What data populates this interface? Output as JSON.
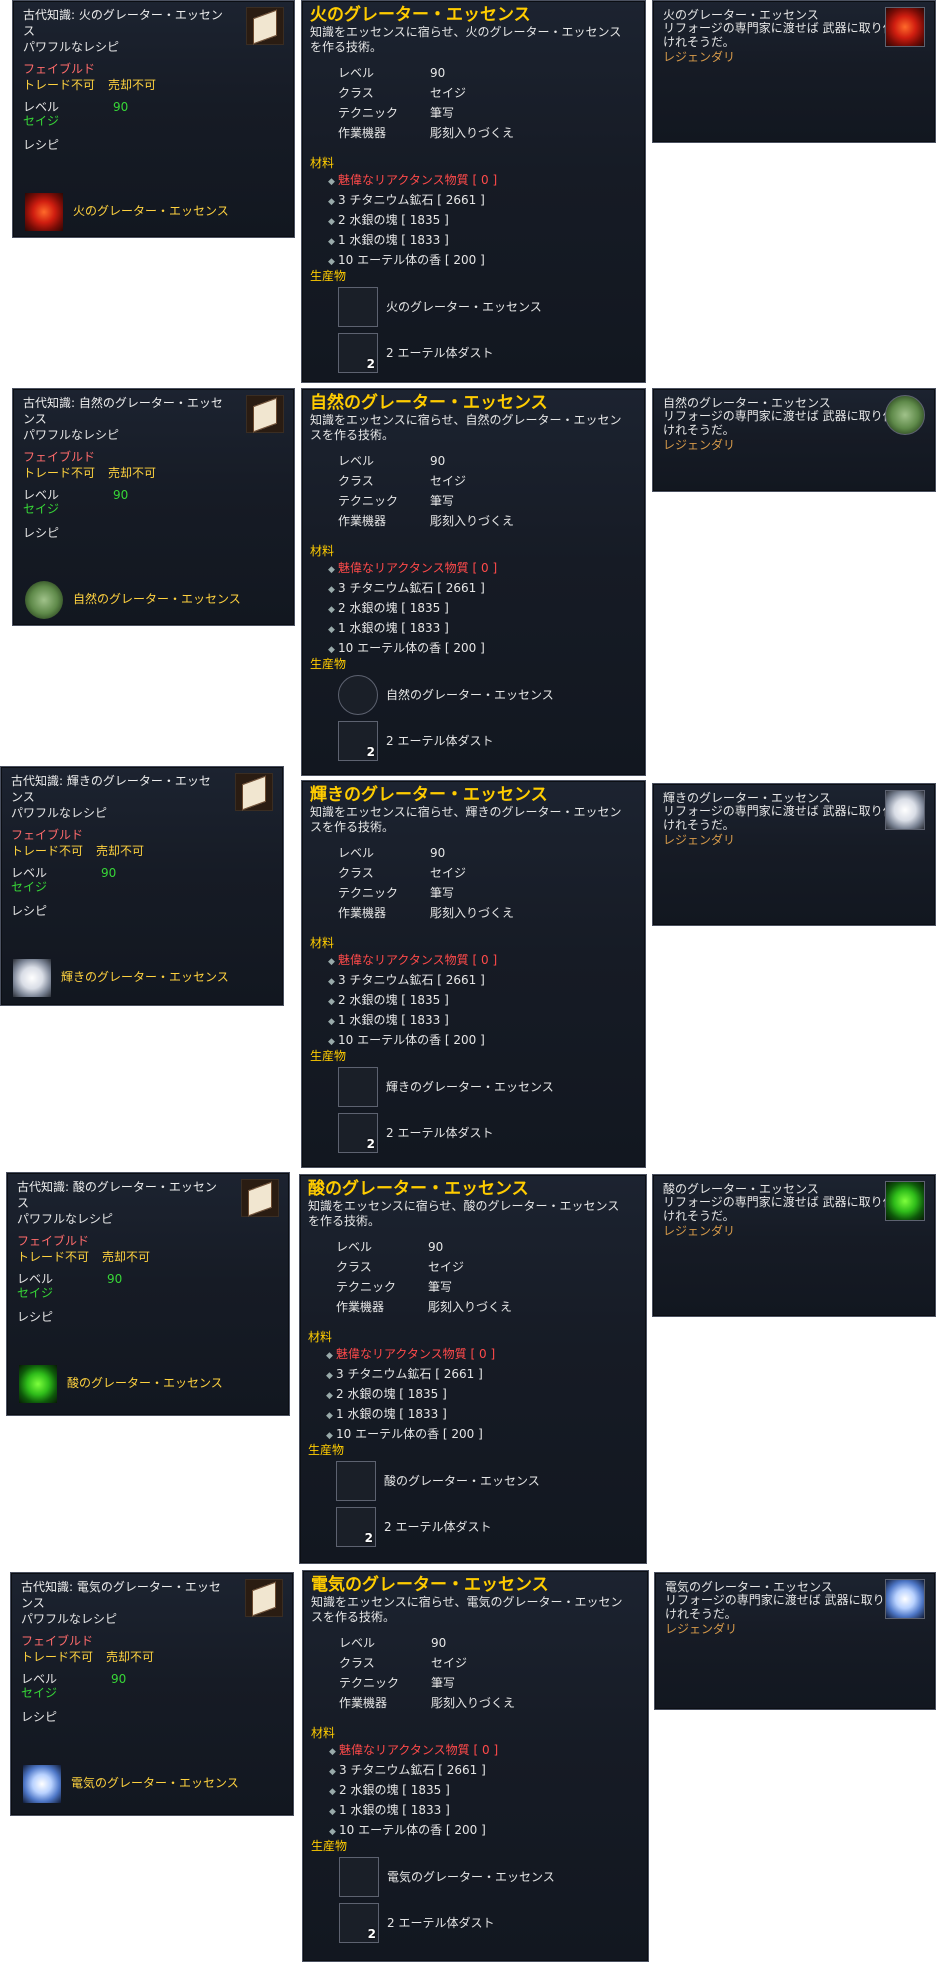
{
  "recipe_common": {
    "subtitle": "パワフルなレシピ",
    "bound": "フェイブルド",
    "no_trade": "トレード不可",
    "no_sell": "売却不可",
    "level_label": "レベル",
    "level_value": "90",
    "class_value": "セイジ",
    "recipe_label": "レシピ"
  },
  "detail_common": {
    "desc_prefix": "知識をエッセンスに宿らせ、",
    "rows": [
      {
        "label": "レベル",
        "value": "90"
      },
      {
        "label": "クラス",
        "value": "セイジ"
      },
      {
        "label": "テクニック",
        "value": "筆写"
      },
      {
        "label": "作業機器",
        "value": "彫刻入りづくえ"
      }
    ],
    "materials_label": "材料",
    "materials": [
      "魅偉なリアクタンス物質 [ 0 ]",
      "3 チタニウム鉱石 [ 2661 ]",
      "2 水銀の塊 [ 1835 ]",
      "1 水銀の塊 [ 1833 ]",
      "10 エーテル体の香 [ 200 ]"
    ],
    "products_label": "生産物",
    "dust_name": "2 エーテル体ダスト",
    "dust_qty": "2"
  },
  "essence_common": {
    "desc": "リフォージの専門家に渡せば 武器に取り付けれそうだ。",
    "rarity": "レジェンダリ"
  },
  "sets": [
    {
      "recipe_title": "古代知識: 火のグレーター・エッセンス",
      "product": "火のグレーター・エッセンス",
      "title": "火のグレーター・エッセンス",
      "desc": "知識をエッセンスに宿らせ、火のグレーター・エッセンスを作る技術。",
      "essence_name": "火のグレーター・エッセンス",
      "icon": "fire-essence-icon"
    },
    {
      "recipe_title": "古代知識: 自然のグレーター・エッセンス",
      "product": "自然のグレーター・エッセンス",
      "title": "自然のグレーター・エッセンス",
      "desc": "知識をエッセンスに宿らせ、自然のグレーター・エッセンスを作る技術。",
      "essence_name": "自然のグレーター・エッセンス",
      "icon": "nature-essence-icon"
    },
    {
      "recipe_title": "古代知識: 輝きのグレーター・エッセンス",
      "product": "輝きのグレーター・エッセンス",
      "title": "輝きのグレーター・エッセンス",
      "desc": "知識をエッセンスに宿らせ、輝きのグレーター・エッセンスを作る技術。",
      "essence_name": "輝きのグレーター・エッセンス",
      "icon": "shine-essence-icon"
    },
    {
      "recipe_title": "古代知識: 酸のグレーター・エッセンス",
      "product": "酸のグレーター・エッセンス",
      "title": "酸のグレーター・エッセンス",
      "desc": "知識をエッセンスに宿らせ、酸のグレーター・エッセンスを作る技術。",
      "essence_name": "酸のグレーター・エッセンス",
      "icon": "acid-essence-icon"
    },
    {
      "recipe_title": "古代知識: 電気のグレーター・エッセンス",
      "product": "電気のグレーター・エッセンス",
      "title": "電気のグレーター・エッセンス",
      "desc": "知識をエッセンスに宿らせ、電気のグレーター・エッセンスを作る技術。",
      "essence_name": "電気のグレーター・エッセンス",
      "icon": "electric-essence-icon"
    }
  ]
}
